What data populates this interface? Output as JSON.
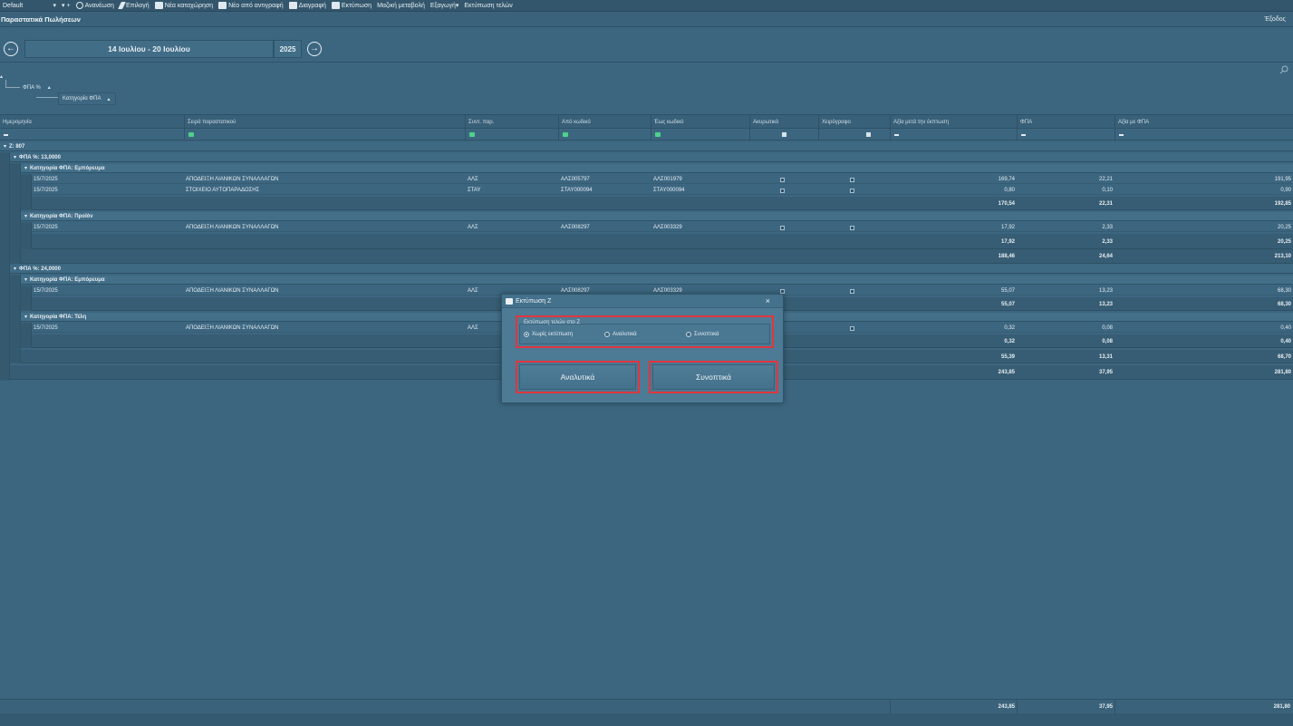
{
  "toolbar": {
    "layout_value": "Default",
    "items": [
      {
        "label": "Ανανέωση",
        "icon": "refresh-icon"
      },
      {
        "label": "Επιλογή",
        "icon": "pencil-icon"
      },
      {
        "label": "Νέα καταχώρηση",
        "icon": "new-record-icon"
      },
      {
        "label": "Νέο από αντιγραφή",
        "icon": "copy-icon"
      },
      {
        "label": "Διαγραφή",
        "icon": "delete-icon"
      },
      {
        "label": "Εκτύπωση",
        "icon": "printer-icon"
      },
      {
        "label": "Μαζική μεταβολή",
        "icon": ""
      },
      {
        "label": "Εξαγωγή",
        "icon": ""
      },
      {
        "label": "Εκτύπωση τελών",
        "icon": ""
      }
    ]
  },
  "page": {
    "title": "Παραστατικά Πωλήσεων",
    "exit_label": "Έξοδος",
    "week_range": "14 Ιουλίου - 20 Ιουλίου",
    "year": "2025"
  },
  "grouping": {
    "level1": "ΦΠΑ %",
    "level2": "Κατηγορία ΦΠΑ"
  },
  "grid": {
    "columns": [
      "Ημερομηνία",
      "Σειρά παραστατικού",
      "Συντ. παρ.",
      "Από κωδικό",
      "Έως κωδικό",
      "Ακυρωτικό",
      "Χειρόγραφο",
      "Αξία μετά την έκπτωση",
      "ΦΠΑ",
      "Αξία με ΦΠΑ"
    ],
    "top_group": "Ζ: 807",
    "groups": [
      {
        "label": "ΦΠΑ %: 13,0000",
        "subgroups": [
          {
            "label": "Κατηγορία ΦΠΑ: Εμπόρευμα",
            "rows": [
              {
                "date": "15/7/2025",
                "series": "ΑΠΟΔΕΙΞΗ ΛΙΑΝΙΚΩΝ ΣΥΝΑΛΛΑΓΩΝ",
                "abbr": "ΑΛΣ",
                "from": "ΑΛΣ005797",
                "to": "ΑΛΣ001979",
                "net": "169,74",
                "vat": "22,21",
                "gross": "191,95"
              },
              {
                "date": "15/7/2025",
                "series": "ΣΤΟΙΧΕΙΟ ΑΥΤΟΠΑΡΑΔΟΣΗΣ",
                "abbr": "ΣΤΑΥ",
                "from": "ΣΤΑΥ000094",
                "to": "ΣΤΑΥ000094",
                "net": "0,80",
                "vat": "0,10",
                "gross": "0,90"
              }
            ],
            "sum": {
              "net": "170,54",
              "vat": "22,31",
              "gross": "192,85"
            }
          },
          {
            "label": "Κατηγορία ΦΠΑ: Προϊόν",
            "rows": [
              {
                "date": "15/7/2025",
                "series": "ΑΠΟΔΕΙΞΗ ΛΙΑΝΙΚΩΝ ΣΥΝΑΛΛΑΓΩΝ",
                "abbr": "ΑΛΣ",
                "from": "ΑΛΣ008297",
                "to": "ΑΛΣ003329",
                "net": "17,92",
                "vat": "2,33",
                "gross": "20,25"
              }
            ],
            "sum": {
              "net": "17,92",
              "vat": "2,33",
              "gross": "20,25"
            }
          }
        ],
        "sum": {
          "net": "188,46",
          "vat": "24,64",
          "gross": "213,10"
        }
      },
      {
        "label": "ΦΠΑ %: 24,0000",
        "subgroups": [
          {
            "label": "Κατηγορία ΦΠΑ: Εμπόρευμα",
            "rows": [
              {
                "date": "15/7/2025",
                "series": "ΑΠΟΔΕΙΞΗ ΛΙΑΝΙΚΩΝ ΣΥΝΑΛΛΑΓΩΝ",
                "abbr": "ΑΛΣ",
                "from": "ΑΛΣ008297",
                "to": "ΑΛΣ003329",
                "net": "55,07",
                "vat": "13,23",
                "gross": "68,30"
              }
            ],
            "sum": {
              "net": "55,07",
              "vat": "13,23",
              "gross": "68,30"
            }
          },
          {
            "label": "Κατηγορία ΦΠΑ: Τέλη",
            "rows": [
              {
                "date": "15/7/2025",
                "series": "ΑΠΟΔΕΙΞΗ ΛΙΑΝΙΚΩΝ ΣΥΝΑΛΛΑΓΩΝ",
                "abbr": "ΑΛΣ",
                "from": "",
                "to": "",
                "net": "0,32",
                "vat": "0,08",
                "gross": "0,40"
              }
            ],
            "sum": {
              "net": "0,32",
              "vat": "0,08",
              "gross": "0,40"
            }
          }
        ],
        "sum": {
          "net": "55,39",
          "vat": "13,31",
          "gross": "68,70"
        }
      }
    ],
    "top_sum": {
      "net": "243,85",
      "vat": "37,95",
      "gross": "281,80"
    },
    "footer_sum": {
      "net": "243,85",
      "vat": "37,95",
      "gross": "281,80"
    }
  },
  "dialog": {
    "title": "Εκτύπωση Ζ",
    "close": "×",
    "options_label": "Εκτύπωση τελών στο Ζ",
    "options": [
      "Χωρίς εκτύπωση",
      "Αναλυτικά",
      "Συνοπτικά"
    ],
    "selected_option": "Χωρίς εκτύπωση",
    "button_detailed": "Αναλυτικά",
    "button_summary": "Συνοπτικά"
  },
  "colors": {
    "background": "#3c6680",
    "highlight_border": "#e0363e",
    "filter_icon": "#4fd18a"
  }
}
